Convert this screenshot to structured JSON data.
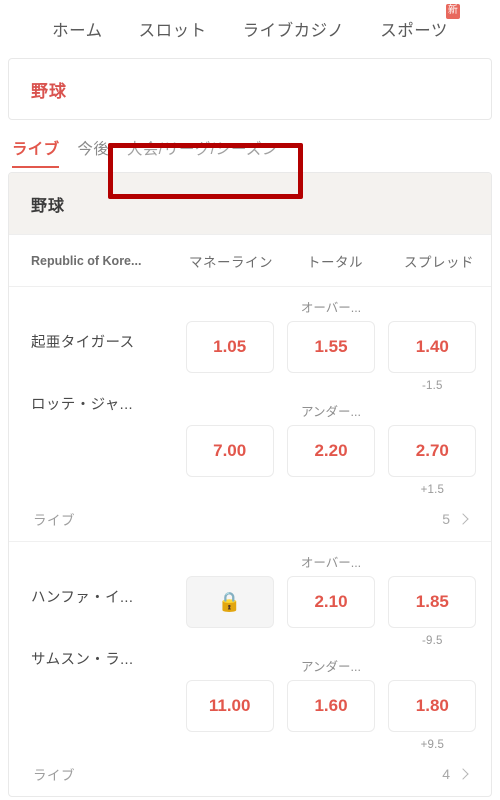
{
  "nav": {
    "items": [
      {
        "label": "ホーム",
        "badge": null
      },
      {
        "label": "スロット",
        "badge": null
      },
      {
        "label": "ライブカジノ",
        "badge": null
      },
      {
        "label": "スポーツ",
        "badge": "新"
      }
    ]
  },
  "sport_selector": {
    "value": "野球"
  },
  "tabs": [
    {
      "label": "ライブ",
      "active": true
    },
    {
      "label": "今後",
      "active": false
    },
    {
      "label": "大会/リーグ/シーズン",
      "active": false
    }
  ],
  "annotation": {
    "target_tab": "大会/リーグ/シーズン",
    "color": "#b30000"
  },
  "league_card": {
    "title": "野球",
    "columns": {
      "team": "Republic of Kore...",
      "moneyline": "マネーライン",
      "total": "トータル",
      "spread": "スプレッド"
    },
    "matches": [
      {
        "teams": [
          "起亜タイガース",
          "ロッテ・ジャ..."
        ],
        "moneyline": [
          {
            "value": "1.05",
            "locked": false
          },
          {
            "value": "7.00",
            "locked": false
          }
        ],
        "total": [
          {
            "label": "オーバー...",
            "value": "1.55",
            "locked": false
          },
          {
            "label": "アンダー...",
            "value": "2.20",
            "locked": false
          }
        ],
        "spread": [
          {
            "value": "1.40",
            "handicap": "-1.5",
            "locked": false
          },
          {
            "value": "2.70",
            "handicap": "+1.5",
            "locked": false
          }
        ],
        "footer": {
          "status": "ライブ",
          "count": "5"
        }
      },
      {
        "teams": [
          "ハンファ・イ...",
          "サムスン・ラ..."
        ],
        "moneyline": [
          {
            "value": "",
            "locked": true,
            "icon": "lock-icon"
          },
          {
            "value": "11.00",
            "locked": false
          }
        ],
        "total": [
          {
            "label": "オーバー...",
            "value": "2.10",
            "locked": false
          },
          {
            "label": "アンダー...",
            "value": "1.60",
            "locked": false
          }
        ],
        "spread": [
          {
            "value": "1.85",
            "handicap": "-9.5",
            "locked": false
          },
          {
            "value": "1.80",
            "handicap": "+9.5",
            "locked": false
          }
        ],
        "footer": {
          "status": "ライブ",
          "count": "4"
        }
      }
    ]
  },
  "colors": {
    "accent_red": "#e2574c",
    "sport_red": "#d9534f",
    "badge_red": "#e8685d",
    "annotation_red": "#b30000",
    "header_bg": "#f4f2ef"
  }
}
